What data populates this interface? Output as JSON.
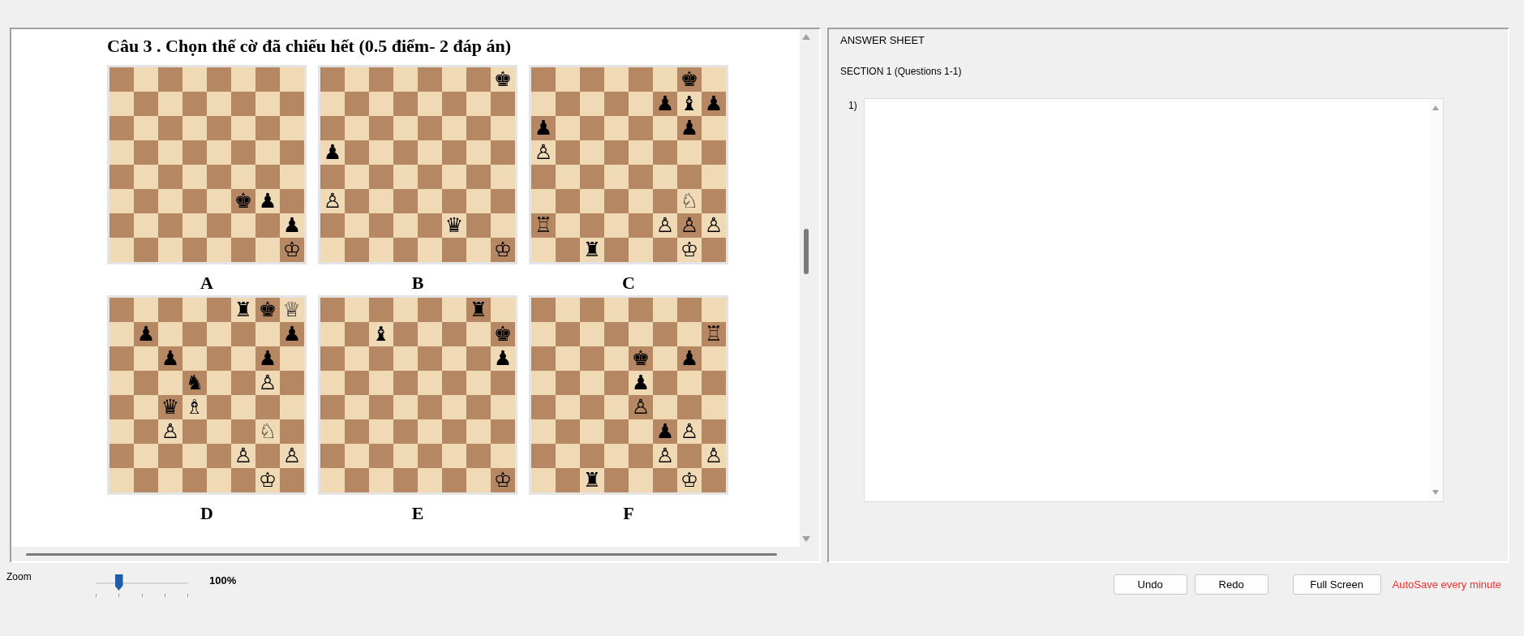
{
  "question": {
    "title": "Câu 3 . Chọn thế cờ đã chiếu hết (0.5 điểm- 2 đáp án)",
    "boards": [
      {
        "label": "A",
        "rows": [
          [
            null,
            null,
            null,
            null,
            null,
            null,
            null,
            null
          ],
          [
            null,
            null,
            null,
            null,
            null,
            null,
            null,
            null
          ],
          [
            null,
            null,
            null,
            null,
            null,
            null,
            null,
            null
          ],
          [
            null,
            null,
            null,
            null,
            null,
            null,
            null,
            null
          ],
          [
            null,
            null,
            null,
            null,
            null,
            null,
            null,
            null
          ],
          [
            null,
            null,
            null,
            null,
            null,
            "♚",
            "♟",
            null
          ],
          [
            null,
            null,
            null,
            null,
            null,
            null,
            null,
            "♟"
          ],
          [
            null,
            null,
            null,
            null,
            null,
            null,
            null,
            "♔"
          ]
        ]
      },
      {
        "label": "B",
        "rows": [
          [
            null,
            null,
            null,
            null,
            null,
            null,
            null,
            "♚"
          ],
          [
            null,
            null,
            null,
            null,
            null,
            null,
            null,
            null
          ],
          [
            null,
            null,
            null,
            null,
            null,
            null,
            null,
            null
          ],
          [
            "♟",
            null,
            null,
            null,
            null,
            null,
            null,
            null
          ],
          [
            null,
            null,
            null,
            null,
            null,
            null,
            null,
            null
          ],
          [
            "♙",
            null,
            null,
            null,
            null,
            null,
            null,
            null
          ],
          [
            null,
            null,
            null,
            null,
            null,
            "♛",
            null,
            null
          ],
          [
            null,
            null,
            null,
            null,
            null,
            null,
            null,
            "♔"
          ]
        ]
      },
      {
        "label": "C",
        "rows": [
          [
            null,
            null,
            null,
            null,
            null,
            null,
            "♚",
            null
          ],
          [
            null,
            null,
            null,
            null,
            null,
            "♟",
            "♝",
            "♟"
          ],
          [
            "♟",
            null,
            null,
            null,
            null,
            null,
            "♟",
            null
          ],
          [
            "♙",
            null,
            null,
            null,
            null,
            null,
            null,
            null
          ],
          [
            null,
            null,
            null,
            null,
            null,
            null,
            null,
            null
          ],
          [
            null,
            null,
            null,
            null,
            null,
            null,
            "♘",
            null
          ],
          [
            "♖",
            null,
            null,
            null,
            null,
            "♙",
            "♙",
            "♙"
          ],
          [
            null,
            null,
            "♜",
            null,
            null,
            null,
            "♔",
            null
          ]
        ]
      },
      {
        "label": "D",
        "rows": [
          [
            null,
            null,
            null,
            null,
            null,
            "♜",
            "♚",
            "♕"
          ],
          [
            null,
            "♟",
            null,
            null,
            null,
            null,
            null,
            "♟"
          ],
          [
            null,
            null,
            "♟",
            null,
            null,
            null,
            "♟",
            null
          ],
          [
            null,
            null,
            null,
            "♞",
            null,
            null,
            "♙",
            null
          ],
          [
            null,
            null,
            "♛",
            "♗",
            null,
            null,
            null,
            null
          ],
          [
            null,
            null,
            "♙",
            null,
            null,
            null,
            "♘",
            null
          ],
          [
            null,
            null,
            null,
            null,
            null,
            "♙",
            null,
            "♙"
          ],
          [
            null,
            null,
            null,
            null,
            null,
            null,
            "♔",
            null
          ]
        ]
      },
      {
        "label": "E",
        "rows": [
          [
            null,
            null,
            null,
            null,
            null,
            null,
            "♜",
            null
          ],
          [
            null,
            null,
            "♝",
            null,
            null,
            null,
            null,
            "♚"
          ],
          [
            null,
            null,
            null,
            null,
            null,
            null,
            null,
            "♟"
          ],
          [
            null,
            null,
            null,
            null,
            null,
            null,
            null,
            null
          ],
          [
            null,
            null,
            null,
            null,
            null,
            null,
            null,
            null
          ],
          [
            null,
            null,
            null,
            null,
            null,
            null,
            null,
            null
          ],
          [
            null,
            null,
            null,
            null,
            null,
            null,
            null,
            null
          ],
          [
            null,
            null,
            null,
            null,
            null,
            null,
            null,
            "♔"
          ]
        ]
      },
      {
        "label": "F",
        "rows": [
          [
            null,
            null,
            null,
            null,
            null,
            null,
            null,
            null
          ],
          [
            null,
            null,
            null,
            null,
            null,
            null,
            null,
            "♖"
          ],
          [
            null,
            null,
            null,
            null,
            "♚",
            null,
            "♟",
            null
          ],
          [
            null,
            null,
            null,
            null,
            "♟",
            null,
            null,
            null
          ],
          [
            null,
            null,
            null,
            null,
            "♙",
            null,
            null,
            null
          ],
          [
            null,
            null,
            null,
            null,
            null,
            "♟",
            "♙",
            null
          ],
          [
            null,
            null,
            null,
            null,
            null,
            "♙",
            null,
            "♙"
          ],
          [
            null,
            null,
            "♜",
            null,
            null,
            null,
            "♔",
            null
          ]
        ]
      }
    ]
  },
  "answer_sheet": {
    "title": "ANSWER SHEET",
    "section": "SECTION 1 (Questions 1-1)",
    "answers": [
      {
        "number": "1)"
      }
    ]
  },
  "zoom": {
    "label": "Zoom",
    "level": 0.25,
    "reading": "100%"
  },
  "buttons": [
    "Undo",
    "Redo",
    "Full Screen"
  ],
  "autosave": "AutoSave every minute"
}
